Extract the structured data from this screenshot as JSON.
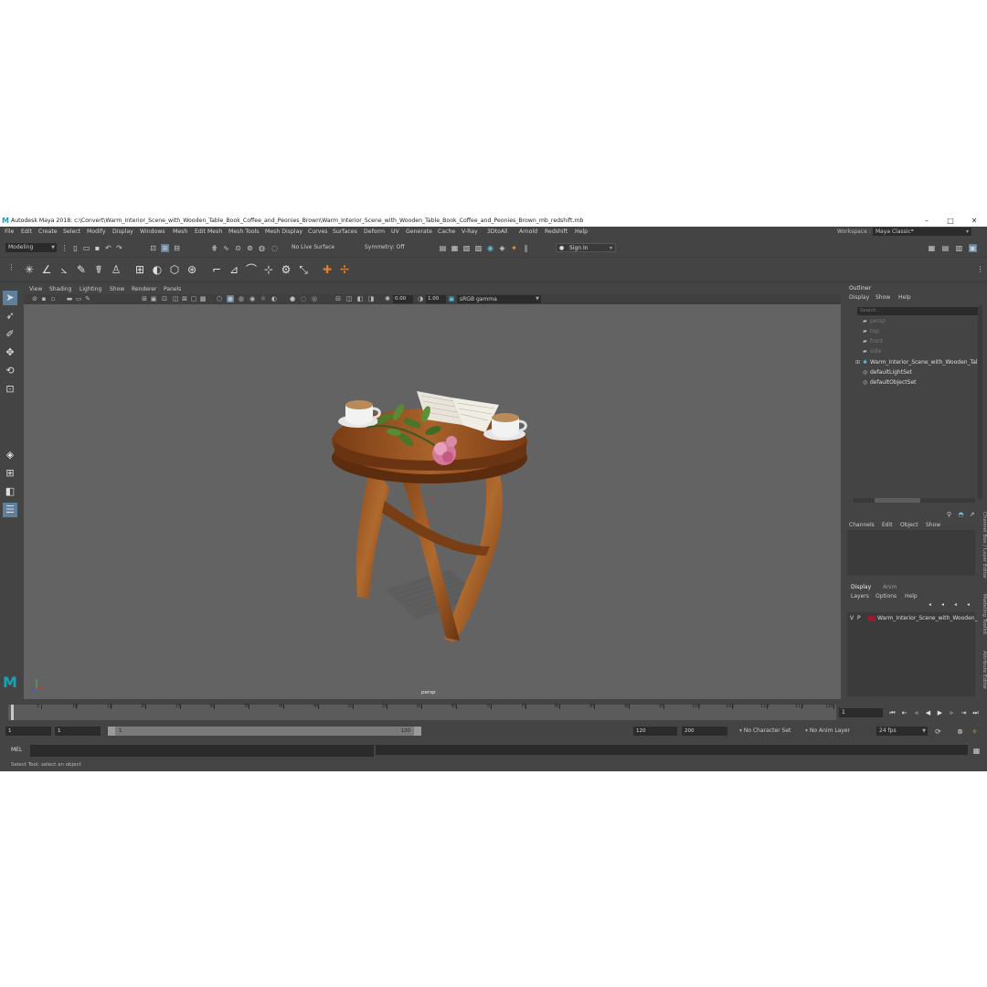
{
  "title_bar": {
    "title": "Autodesk Maya 2018: c:\\Convert\\Warm_Interior_Scene_with_Wooden_Table_Book_Coffee_and_Peonies_Brown\\Warm_Interior_Scene_with_Wooden_Table_Book_Coffee_and_Peonies_Brown_mb_redshift.mb",
    "logo": "M",
    "minimize": "–",
    "maximize": "□",
    "close": "✕"
  },
  "menu": {
    "items": [
      "File",
      "Edit",
      "Create",
      "Select",
      "Modify",
      "Display",
      "Windows",
      "Mesh",
      "Edit Mesh",
      "Mesh Tools",
      "Mesh Display",
      "Curves",
      "Surfaces",
      "Deform",
      "UV",
      "Generate",
      "Cache",
      "V-Ray",
      "3DtoAll",
      "Arnold",
      "Redshift",
      "Help"
    ],
    "workspace_label": "Workspace :",
    "workspace_value": "Maya Classic*"
  },
  "status_line": {
    "mode": "Modeling",
    "live_surface": "No Live Surface",
    "symmetry": "Symmetry: Off",
    "sign_in": "Sign In"
  },
  "viewport": {
    "menu": [
      "View",
      "Shading",
      "Lighting",
      "Show",
      "Renderer",
      "Panels"
    ],
    "exposure": "0.00",
    "gamma": "1.00",
    "color_space": "sRGB gamma",
    "camera_label": "persp"
  },
  "outliner": {
    "title": "Outliner",
    "menu": [
      "Display",
      "Show",
      "Help"
    ],
    "search_placeholder": "Search...",
    "items": [
      {
        "label": "persp",
        "dim": true,
        "icon": "camera-icon"
      },
      {
        "label": "top",
        "dim": true,
        "icon": "camera-icon"
      },
      {
        "label": "front",
        "dim": true,
        "icon": "camera-icon"
      },
      {
        "label": "side",
        "dim": true,
        "icon": "camera-icon"
      },
      {
        "label": "Warm_Interior_Scene_with_Wooden_Tal",
        "dim": false,
        "icon": "group-icon"
      },
      {
        "label": "defaultLightSet",
        "dim": false,
        "icon": "set-icon"
      },
      {
        "label": "defaultObjectSet",
        "dim": false,
        "icon": "set-icon"
      }
    ]
  },
  "channel_box": {
    "menu": [
      "Channels",
      "Edit",
      "Object",
      "Show"
    ]
  },
  "layer_editor": {
    "tabs": [
      "Display",
      "Anim"
    ],
    "menu": [
      "Layers",
      "Options",
      "Help"
    ],
    "layer": {
      "v": "V",
      "p": "P",
      "name": "Warm_Interior_Scene_with_Wooden_",
      "color": "#9b1b2e"
    }
  },
  "side_tabs": [
    "Channel Box / Layer Editor",
    "Modeling Toolkit",
    "Attribute Editor"
  ],
  "time_slider": {
    "ticks": [
      "5",
      "10",
      "15",
      "20",
      "25",
      "30",
      "35",
      "40",
      "45",
      "50",
      "55",
      "60",
      "65",
      "70",
      "75",
      "80",
      "85",
      "90",
      "95",
      "100",
      "105",
      "110",
      "115",
      "120"
    ],
    "current_frame": "1"
  },
  "range_slider": {
    "start": "1",
    "playback_start": "1",
    "slider_start": "1",
    "slider_end": "120",
    "playback_end": "120",
    "end": "200",
    "character_set": "No Character Set",
    "anim_layer": "No Anim Layer",
    "fps": "24 fps"
  },
  "command_line": {
    "label": "MEL"
  },
  "help_line": {
    "text": "Select Tool: select an object"
  }
}
